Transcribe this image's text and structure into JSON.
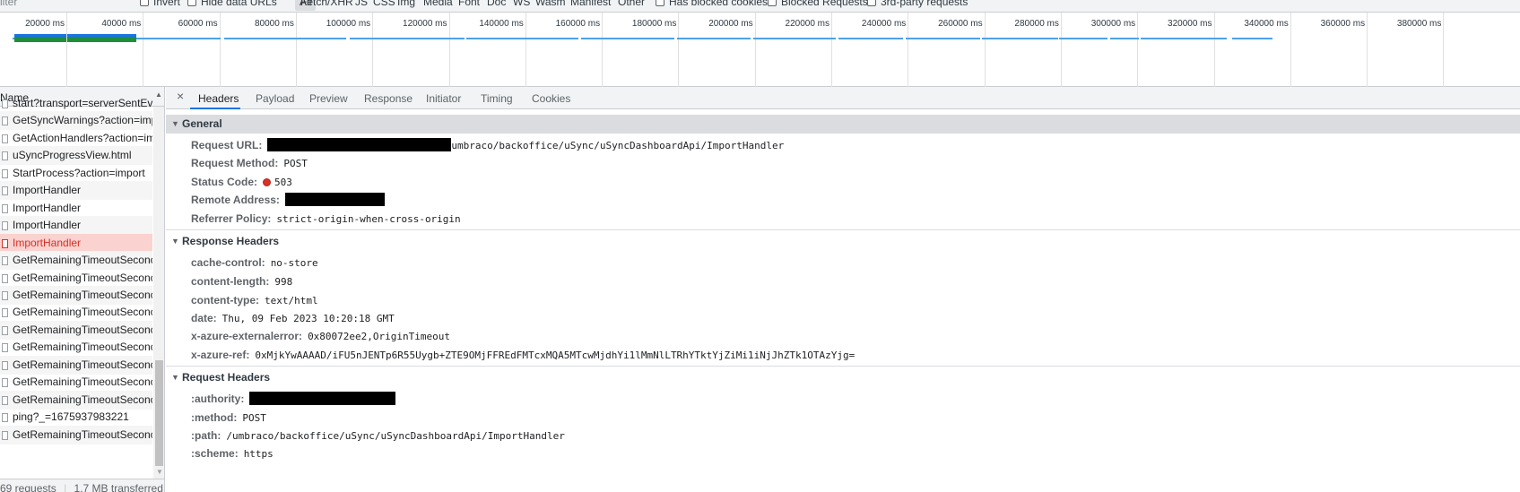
{
  "filter_bar": {
    "filter_placeholder": "ilter",
    "invert_label": "Invert",
    "hide_data_urls_label": "Hide data URLs",
    "types": [
      "All",
      "Fetch/XHR",
      "JS",
      "CSS",
      "Img",
      "Media",
      "Font",
      "Doc",
      "WS",
      "Wasm",
      "Manifest",
      "Other"
    ],
    "has_blocked_cookies_label": "Has blocked cookies",
    "blocked_requests_label": "Blocked Requests",
    "third_party_label": "3rd-party requests"
  },
  "overview": {
    "ticks": [
      "20000 ms",
      "40000 ms",
      "60000 ms",
      "80000 ms",
      "100000 ms",
      "120000 ms",
      "140000 ms",
      "160000 ms",
      "180000 ms",
      "200000 ms",
      "220000 ms",
      "240000 ms",
      "260000 ms",
      "280000 ms",
      "300000 ms",
      "320000 ms",
      "340000 ms",
      "360000 ms",
      "380000 ms"
    ],
    "bar_color": "#1a73e8",
    "highlight_color": "#1e8e3e"
  },
  "request_list": {
    "header": "Name",
    "rows": [
      {
        "name": "start?transport=serverSentEve",
        "error": false
      },
      {
        "name": "GetSyncWarnings?action=imp",
        "error": false
      },
      {
        "name": "GetActionHandlers?action=im",
        "error": false
      },
      {
        "name": "uSyncProgressView.html",
        "error": false
      },
      {
        "name": "StartProcess?action=import",
        "error": false
      },
      {
        "name": "ImportHandler",
        "error": false
      },
      {
        "name": "ImportHandler",
        "error": false
      },
      {
        "name": "ImportHandler",
        "error": false
      },
      {
        "name": "ImportHandler",
        "error": true
      },
      {
        "name": "GetRemainingTimeoutSeconc",
        "error": false
      },
      {
        "name": "GetRemainingTimeoutSeconc",
        "error": false
      },
      {
        "name": "GetRemainingTimeoutSeconc",
        "error": false
      },
      {
        "name": "GetRemainingTimeoutSeconc",
        "error": false
      },
      {
        "name": "GetRemainingTimeoutSeconc",
        "error": false
      },
      {
        "name": "GetRemainingTimeoutSeconc",
        "error": false
      },
      {
        "name": "GetRemainingTimeoutSeconc",
        "error": false
      },
      {
        "name": "GetRemainingTimeoutSeconc",
        "error": false
      },
      {
        "name": "GetRemainingTimeoutSeconc",
        "error": false
      },
      {
        "name": "ping?_=1675937983221",
        "error": false
      },
      {
        "name": "GetRemainingTimeoutSeconc",
        "error": false
      }
    ],
    "status_text": "69 requests",
    "transferred_text": "1.7 MB transferred",
    "error_color": "#d93025"
  },
  "detail": {
    "close_symbol": "×",
    "tabs": [
      "Headers",
      "Payload",
      "Preview",
      "Response",
      "Initiator",
      "Timing",
      "Cookies"
    ],
    "general": {
      "title": "General",
      "request_url_key": "Request URL:",
      "request_url_value": "umbraco/backoffice/uSync/uSyncDashboardApi/ImportHandler",
      "request_method_key": "Request Method:",
      "request_method_value": "POST",
      "status_code_key": "Status Code:",
      "status_code_value": "503",
      "remote_address_key": "Remote Address:",
      "referrer_policy_key": "Referrer Policy:",
      "referrer_policy_value": "strict-origin-when-cross-origin"
    },
    "response_headers": {
      "title": "Response Headers",
      "items": [
        {
          "key": "cache-control:",
          "value": "no-store"
        },
        {
          "key": "content-length:",
          "value": "998"
        },
        {
          "key": "content-type:",
          "value": "text/html"
        },
        {
          "key": "date:",
          "value": "Thu, 09 Feb 2023 10:20:18 GMT"
        },
        {
          "key": "x-azure-externalerror:",
          "value": "0x80072ee2,OriginTimeout"
        },
        {
          "key": "x-azure-ref:",
          "value": "0xMjkYwAAAAD/iFU5nJENTp6R55Uygb+ZTE9OMjFFREdFMTcxMQA5MTcwMjdhYi1lMmNlLTRhYTktYjZiMi1iNjJhZTk1OTAzYjg="
        }
      ]
    },
    "request_headers": {
      "title": "Request Headers",
      "authority_key": ":authority:",
      "method_key": ":method:",
      "method_value": "POST",
      "path_key": ":path:",
      "path_value": "/umbraco/backoffice/uSync/uSyncDashboardApi/ImportHandler",
      "scheme_key": ":scheme:",
      "scheme_value": "https"
    }
  }
}
